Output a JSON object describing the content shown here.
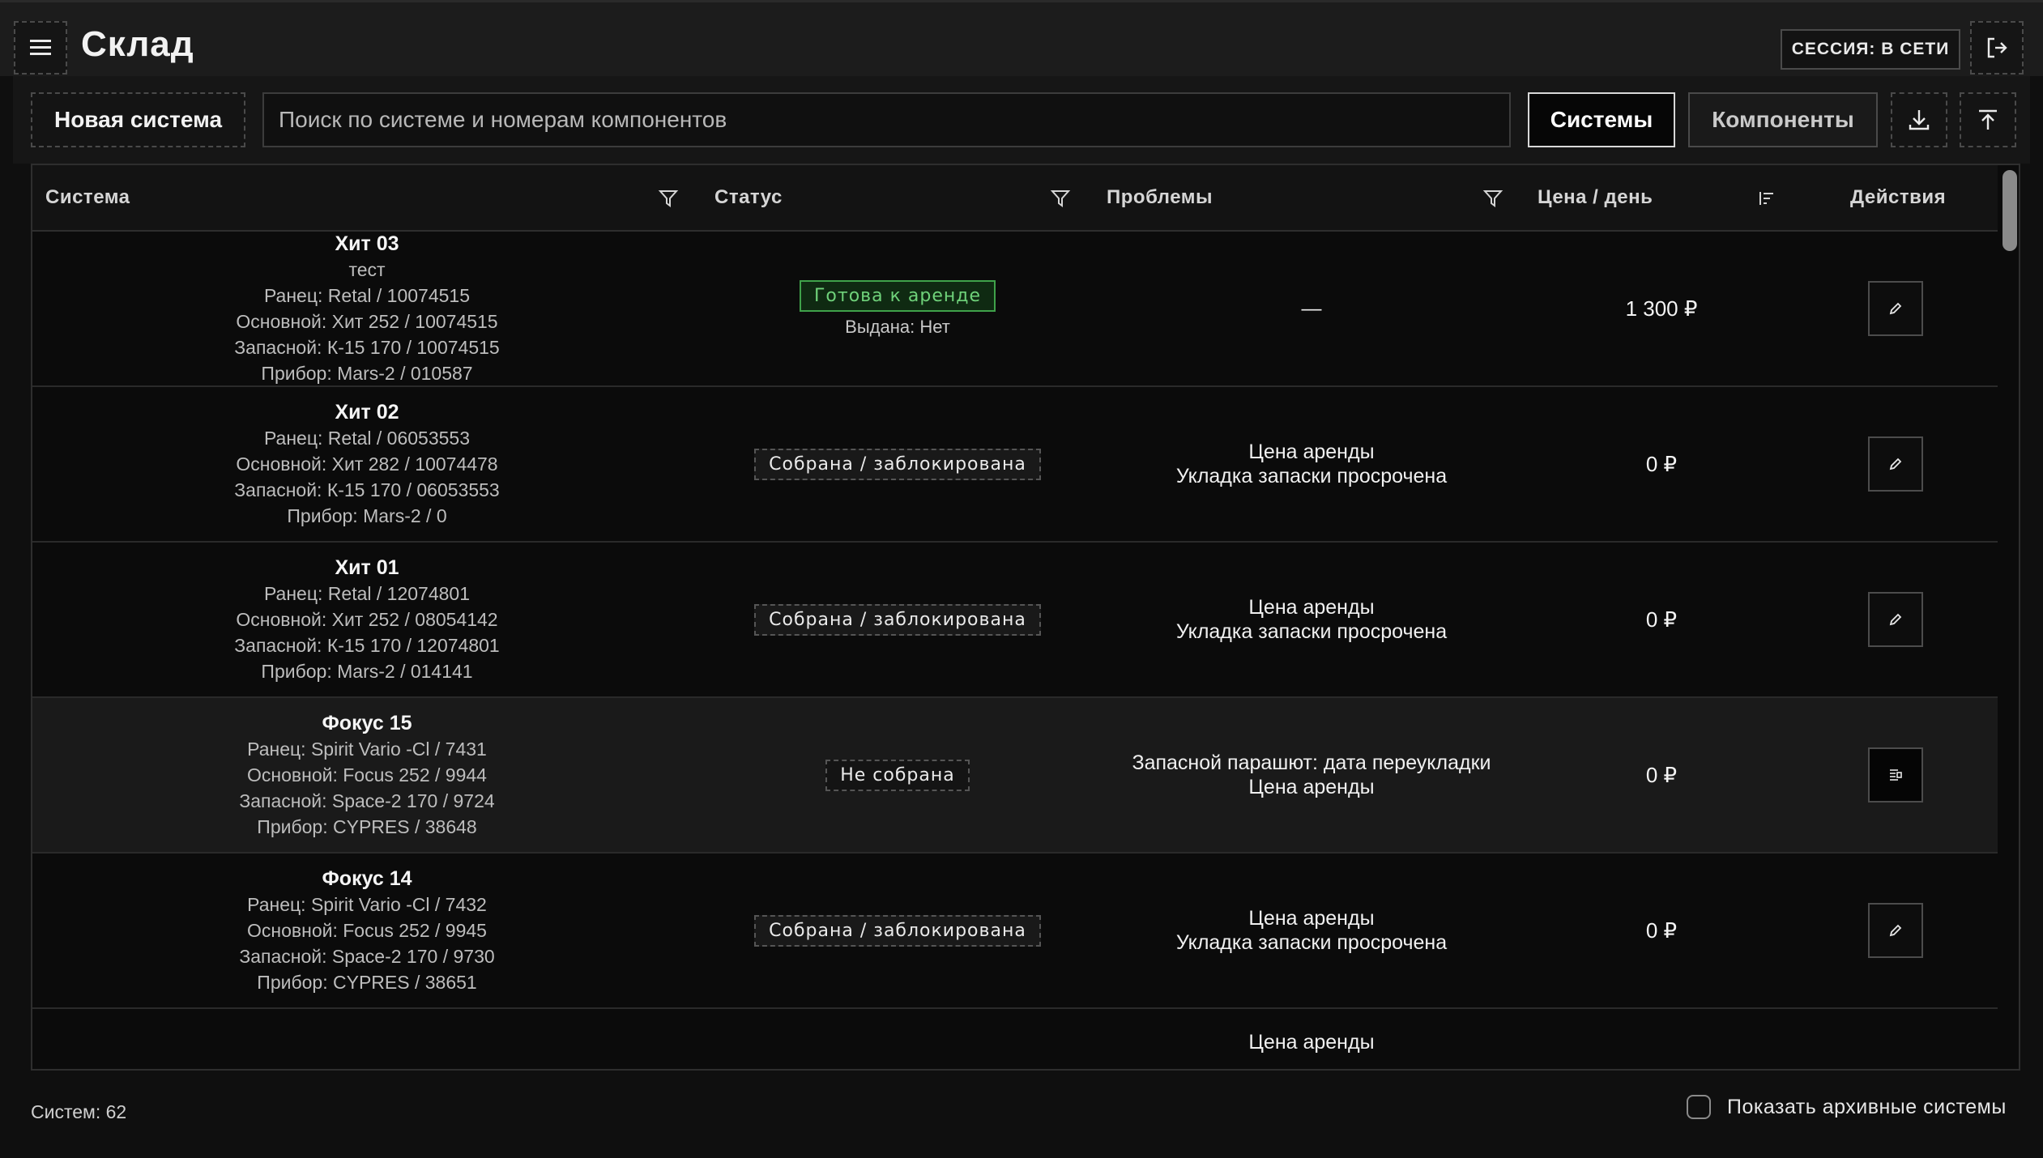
{
  "header": {
    "title": "Склад",
    "session": "СЕССИЯ: В СЕТИ",
    "menu_icon": "menu-icon",
    "logout_icon": "logout-icon"
  },
  "toolbar": {
    "new_system": "Новая система",
    "search_placeholder": "Поиск по системе и номерам компонентов",
    "search_value": "",
    "tab_systems": "Системы",
    "tab_components": "Компоненты",
    "active_tab": "Системы",
    "download_icon": "download-icon",
    "upload_icon": "upload-icon"
  },
  "table": {
    "columns": {
      "system": "Система",
      "status": "Статус",
      "problems": "Проблемы",
      "price": "Цена / день",
      "actions": "Действия"
    },
    "rows": [
      {
        "name": "Хит 03",
        "note": "тест",
        "lines": [
          "Ранец: Retal / 10074515",
          "Основной: Хит 252 / 10074515",
          "Запасной: К-15 170 / 10074515",
          "Прибор: Mars-2 / 010587"
        ],
        "status": "Готова к аренде",
        "status_type": "ready",
        "issued": "Выдана: Нет",
        "problems": [
          "—"
        ],
        "price": "1 300 ₽",
        "action_icon": "edit-icon"
      },
      {
        "name": "Хит 02",
        "lines": [
          "Ранец: Retal / 06053553",
          "Основной: Хит 282 / 10074478",
          "Запасной: К-15 170 / 06053553",
          "Прибор: Mars-2 / 0"
        ],
        "status": "Собрана / заблокирована",
        "status_type": "locked",
        "problems": [
          "Цена аренды",
          "Укладка запаски просрочена"
        ],
        "price": "0 ₽",
        "action_icon": "edit-icon"
      },
      {
        "name": "Хит 01",
        "lines": [
          "Ранец: Retal / 12074801",
          "Основной: Хит 252 / 08054142",
          "Запасной: К-15 170 / 12074801",
          "Прибор: Mars-2 / 014141"
        ],
        "status": "Собрана / заблокирована",
        "status_type": "locked",
        "problems": [
          "Цена аренды",
          "Укладка запаски просрочена"
        ],
        "price": "0 ₽",
        "action_icon": "edit-icon"
      },
      {
        "name": "Фокус 15",
        "lines": [
          "Ранец: Spirit Vario -Cl / 7431",
          "Основной: Focus 252 / 9944",
          "Запасной: Space-2 170 / 9724",
          "Прибор: CYPRES / 38648"
        ],
        "status": "Не собрана",
        "status_type": "unassembled",
        "problems": [
          "Запасной парашют: дата переукладки",
          "Цена аренды"
        ],
        "price": "0 ₽",
        "action_icon": "assemble-icon",
        "highlight": true
      },
      {
        "name": "Фокус 14",
        "lines": [
          "Ранец: Spirit Vario -Cl / 7432",
          "Основной: Focus 252 / 9945",
          "Запасной: Space-2 170 / 9730",
          "Прибор: CYPRES / 38651"
        ],
        "status": "Собрана / заблокирована",
        "status_type": "locked",
        "problems": [
          "Цена аренды",
          "Укладка запаски просрочена"
        ],
        "price": "0 ₽",
        "action_icon": "edit-icon"
      }
    ],
    "partial_row_problem": "Цена аренды"
  },
  "footer": {
    "count": "Систем: 62",
    "archive_label": "Показать архивные системы",
    "archive_checked": false
  },
  "colors": {
    "background": "#0f0f0f",
    "ready_green": "#6fd27a",
    "border": "#4a4a4a"
  }
}
